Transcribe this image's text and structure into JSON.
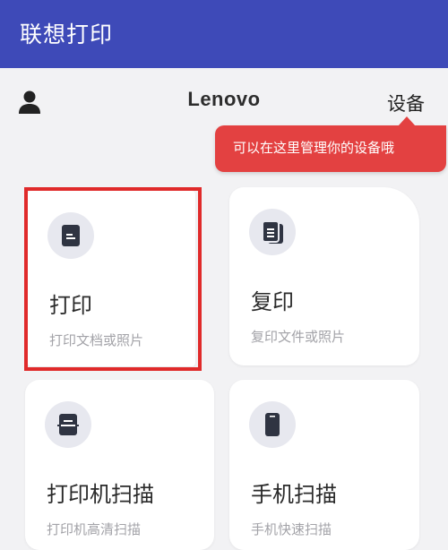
{
  "appbar": {
    "title": "联想打印"
  },
  "header": {
    "brand": "Lenovo",
    "device_label": "设备"
  },
  "tooltip": {
    "text": "可以在这里管理你的设备哦"
  },
  "cards": [
    {
      "title": "打印",
      "subtitle": "打印文档或照片",
      "icon": "document-icon"
    },
    {
      "title": "复印",
      "subtitle": "复印文件或照片",
      "icon": "copy-documents-icon"
    },
    {
      "title": "打印机扫描",
      "subtitle": "打印机高清扫描",
      "icon": "printer-scan-icon"
    },
    {
      "title": "手机扫描",
      "subtitle": "手机快速扫描",
      "icon": "phone-icon"
    }
  ],
  "colors": {
    "appbar": "#3e4ab8",
    "tooltip": "#e34141",
    "highlight_outline": "#e02a2a",
    "background": "#f2f2f4"
  }
}
